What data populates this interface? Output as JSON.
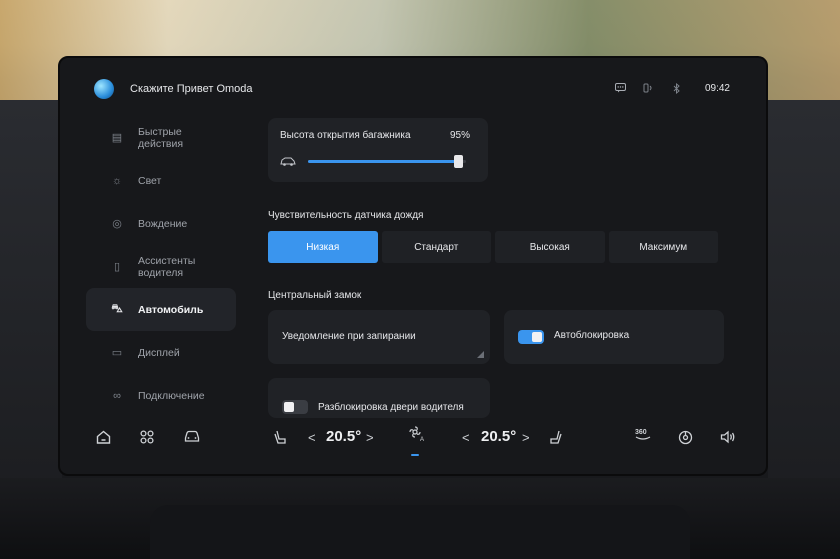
{
  "assistant": {
    "text": "Скажите Привет Omoda"
  },
  "status": {
    "time": "09:42",
    "icons": [
      "message-icon",
      "signal-icon",
      "bluetooth-icon"
    ]
  },
  "sidebar": {
    "items": [
      {
        "label": "Быстрые\nдействия",
        "icon": "quick-actions-icon",
        "glyph": "▤",
        "active": false
      },
      {
        "label": "Свет",
        "icon": "light-icon",
        "glyph": "☼",
        "active": false
      },
      {
        "label": "Вождение",
        "icon": "steering-wheel-icon",
        "glyph": "◎",
        "active": false
      },
      {
        "label": "Ассистенты\nводителя",
        "icon": "driver-assist-icon",
        "glyph": "▯",
        "active": false
      },
      {
        "label": "Автомобиль",
        "icon": "car-icon",
        "glyph": "⛍",
        "active": true
      },
      {
        "label": "Дисплей",
        "icon": "display-icon",
        "glyph": "▭",
        "active": false
      },
      {
        "label": "Подключение",
        "icon": "link-icon",
        "glyph": "∞",
        "active": false
      }
    ]
  },
  "trunk": {
    "title": "Высота открытия багажника",
    "value": "95%",
    "percent": 95
  },
  "rain": {
    "title": "Чувствительность датчика дождя",
    "options": [
      "Низкая",
      "Стандарт",
      "Высокая",
      "Максимум"
    ],
    "selected": 0
  },
  "lock": {
    "title": "Центральный замок",
    "notify_label": "Уведомление при запирании",
    "autolock_label": "Автоблокировка",
    "autolock_on": true,
    "unlock_label": "Разблокировка двери водителя",
    "unlock_on": false
  },
  "dock": {
    "left_temp": "20.5°",
    "right_temp": "20.5°",
    "icons": [
      "home-icon",
      "apps-icon",
      "car-icon",
      "seat-heat-left-icon",
      "fan-auto-icon",
      "seat-heat-right-icon",
      "camera-360-icon",
      "media-icon",
      "volume-icon"
    ],
    "camera_label": "360"
  },
  "colors": {
    "accent": "#3a95ee",
    "background": "#17181b",
    "card": "#202226"
  }
}
